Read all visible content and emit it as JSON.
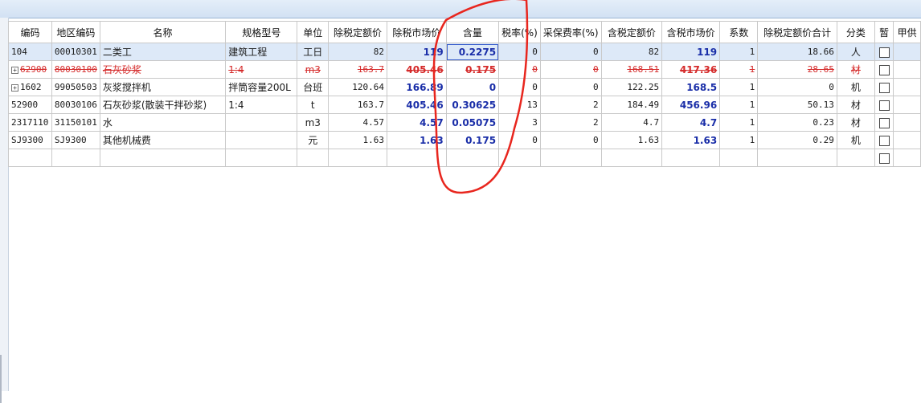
{
  "columns": [
    "编码",
    "地区编码",
    "名称",
    "规格型号",
    "单位",
    "除税定额价",
    "除税市场价",
    "含量",
    "税率(%)",
    "采保费率(%)",
    "含税定额价",
    "含税市场价",
    "系数",
    "除税定额价合计",
    "分类",
    "暂",
    "甲供"
  ],
  "rows": [
    {
      "code": "104",
      "region": "00010301",
      "name": "二类工",
      "spec": "建筑工程",
      "unit": "工日",
      "quota": "82",
      "market": "119",
      "qty": "0.2275",
      "tax": "0",
      "fee": "0",
      "tquota": "82",
      "tmarket": "119",
      "coef": "1",
      "total": "18.66",
      "cat": "人",
      "expand": false,
      "state": "selected"
    },
    {
      "code": "62900",
      "region": "80030100",
      "name": "石灰砂浆",
      "spec": "1:4",
      "unit": "m3",
      "quota": "163.7",
      "market": "405.46",
      "qty": "0.175",
      "tax": "0",
      "fee": "0",
      "tquota": "168.51",
      "tmarket": "417.36",
      "coef": "1",
      "total": "28.65",
      "cat": "材",
      "expand": true,
      "state": "deleted"
    },
    {
      "code": "1602",
      "region": "99050503",
      "name": "灰浆搅拌机",
      "spec": "拌筒容量200L",
      "unit": "台班",
      "quota": "120.64",
      "market": "166.89",
      "qty": "0",
      "tax": "0",
      "fee": "0",
      "tquota": "122.25",
      "tmarket": "168.5",
      "coef": "1",
      "total": "0",
      "cat": "机",
      "expand": true,
      "state": "normal"
    },
    {
      "code": "52900",
      "region": "80030106",
      "name": "石灰砂浆(散装干拌砂浆)",
      "spec": "1:4",
      "unit": "t",
      "quota": "163.7",
      "market": "405.46",
      "qty": "0.30625",
      "tax": "13",
      "fee": "2",
      "tquota": "184.49",
      "tmarket": "456.96",
      "coef": "1",
      "total": "50.13",
      "cat": "材",
      "expand": false,
      "state": "normal"
    },
    {
      "code": "2317110",
      "region": "31150101",
      "name": "水",
      "spec": "",
      "unit": "m3",
      "quota": "4.57",
      "market": "4.57",
      "qty": "0.05075",
      "tax": "3",
      "fee": "2",
      "tquota": "4.7",
      "tmarket": "4.7",
      "coef": "1",
      "total": "0.23",
      "cat": "材",
      "expand": false,
      "state": "normal"
    },
    {
      "code": "SJ9300",
      "region": "SJ9300",
      "name": "其他机械费",
      "spec": "",
      "unit": "元",
      "quota": "1.63",
      "market": "1.63",
      "qty": "0.175",
      "tax": "0",
      "fee": "0",
      "tquota": "1.63",
      "tmarket": "1.63",
      "coef": "1",
      "total": "0.29",
      "cat": "机",
      "expand": false,
      "state": "normal"
    }
  ],
  "colors": {
    "annotation": "#e8261e",
    "bold_value": "#1a2ea8",
    "deleted": "#d52b2b",
    "selected_row": "#dde9f8"
  },
  "icons": {
    "expand": "plus-box-icon",
    "check": "checkbox-icon"
  }
}
